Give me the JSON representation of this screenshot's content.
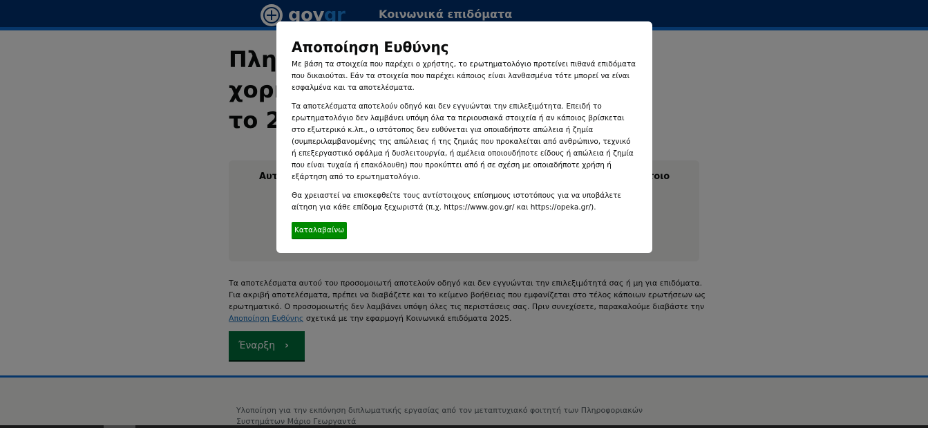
{
  "header": {
    "logo_text_prefix": "gov",
    "logo_text_suffix": "gr",
    "service_title": "Κοινωνικά επιδόματα"
  },
  "main": {
    "page_title_lines": [
      "Πληρ",
      "χορή",
      "το 20"
    ],
    "panel_text_left": "Αυτ",
    "panel_text_right": "τοιο",
    "intro_text_before_link": "Τα αποτελέσματα αυτού του προσομοιωτή αποτελούν οδηγό και δεν εγγυώνται την επιλεξιμότητά σας ή μη για επιδόματα. Για ακριβή αποτελέσματα, πρέπει να διαβάζετε και το κείμενο βοήθειας που εμφανίζεται στο τέλος κάποιων ερωτήσεων ως ερωτηματικό. Ο προσομοιωτής δεν λαμβάνει υπόψη όλες τις περιστάσεις σας. Πριν συνεχίσετε, παρακαλούμε διαβάστε την ",
    "intro_link": "Αποποίηση Ευθύνης",
    "intro_text_after_link": " σχετικά με την εφαρμογή Κοινωνικά επιδόματα 2025.",
    "start_button": "Έναρξη",
    "start_arrow": "›"
  },
  "footer": {
    "text": "Υλοποίηση για την εκπόνηση διπλωματικής εργασίας από τον μεταπτυχιακό φοιτητή των Πληροφοριακών Συστημάτων Μάριο Γεωργαντά"
  },
  "modal": {
    "title": "Αποποίηση Ευθύνης",
    "paragraphs": [
      "Με βάση τα στοιχεία που παρέχει ο χρήστης, το ερωτηματολόγιο προτείνει πιθανά επιδόματα που δικαιούται. Εάν τα στοιχεία που παρέχει κάποιος είναι λανθασμένα τότε μπορεί να είναι εσφαλμένα και τα αποτελέσματα.",
      "Τα αποτελέσματα αποτελούν οδηγό και δεν εγγυώνται την επιλεξιμότητα. Επειδή το ερωτηματολόγιο δεν λαμβάνει υπόψη όλα τα περιουσιακά στοιχεία ή αν κάποιος βρίσκεται στο εξωτερικό κ.λπ., ο ιστότοπος δεν ευθύνεται για οποιαδήποτε απώλεια ή ζημία (συμπεριλαμβανομένης της απώλειας ή της ζημιάς που προκαλείται από ανθρώπινο, τεχνικό ή επεξεργαστικό σφάλμα ή δυσλειτουργία, ή αμέλεια οποιουδήποτε είδους ή απώλεια ή ζημία που είναι τυχαία ή επακόλουθη) που προκύπτει από ή σε σχέση με οποιαδήποτε χρήση ή εξάρτηση από το ερωτηματολόγιο.",
      "Θα χρειαστεί να επισκεφθείτε τους αντίστοιχους επίσημους ιστοτόπους για να υποβάλετε αίτηση για κάθε επίδομα ξεχωριστά (π.χ. https://www.gov.gr/ και https://opeka.gr/)."
    ],
    "ok_button": "Καταλαβαίνω"
  },
  "colors": {
    "header_bg": "#003375",
    "accent_blue": "#0e6dd3",
    "start_green": "#00703c",
    "ok_green": "#008a00"
  }
}
